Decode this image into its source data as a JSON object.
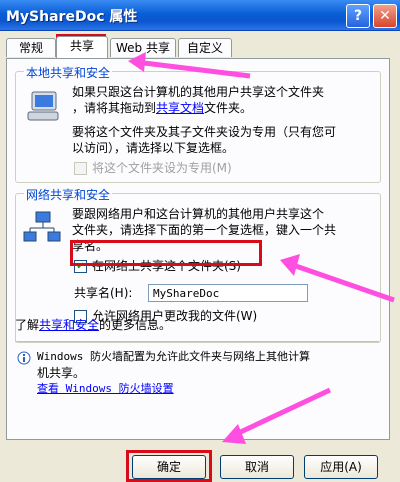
{
  "window": {
    "title": "MyShareDoc 属性",
    "help_label": "?",
    "close_label": "✕"
  },
  "tabs": [
    {
      "label": "常规"
    },
    {
      "label": "共享"
    },
    {
      "label": "Web 共享"
    },
    {
      "label": "自定义"
    }
  ],
  "local": {
    "label": "本地共享和安全",
    "line1": "如果只跟这台计算机的其他用户共享这个文件夹",
    "line2_prefix": "，请将其拖动到",
    "line2_link": "共享文档",
    "line2_suffix": "文件夹。",
    "line3": "要将这个文件夹及其子文件夹设为专用（只有您可",
    "line4": "以访问），请选择以下复选框。",
    "private_checkbox": "将这个文件夹设为专用(M)"
  },
  "network": {
    "label": "网络共享和安全",
    "line1": "要跟网络用户和这台计算机的其他用户共享这个",
    "line2": "文件夹，请选择下面的第一个复选框，键入一个共",
    "line3": "享名。",
    "share_checkbox": "在网络上共享这个文件夹(S)",
    "share_checked": true,
    "share_name_label": "共享名(H):",
    "share_name_value": "MyShareDoc",
    "allow_change_checkbox": "允许网络用户更改我的文件(W)",
    "allow_change_checked": false
  },
  "learn_more": {
    "prefix": "了解",
    "link": "共享和安全",
    "suffix": "的更多信息。"
  },
  "firewall": {
    "line1": "Windows 防火墙配置为允许此文件夹与网络上其他计算",
    "line2": "机共享。",
    "link": "查看 Windows 防火墙设置"
  },
  "buttons": {
    "ok": "确定",
    "cancel": "取消",
    "apply": "应用(A)"
  }
}
